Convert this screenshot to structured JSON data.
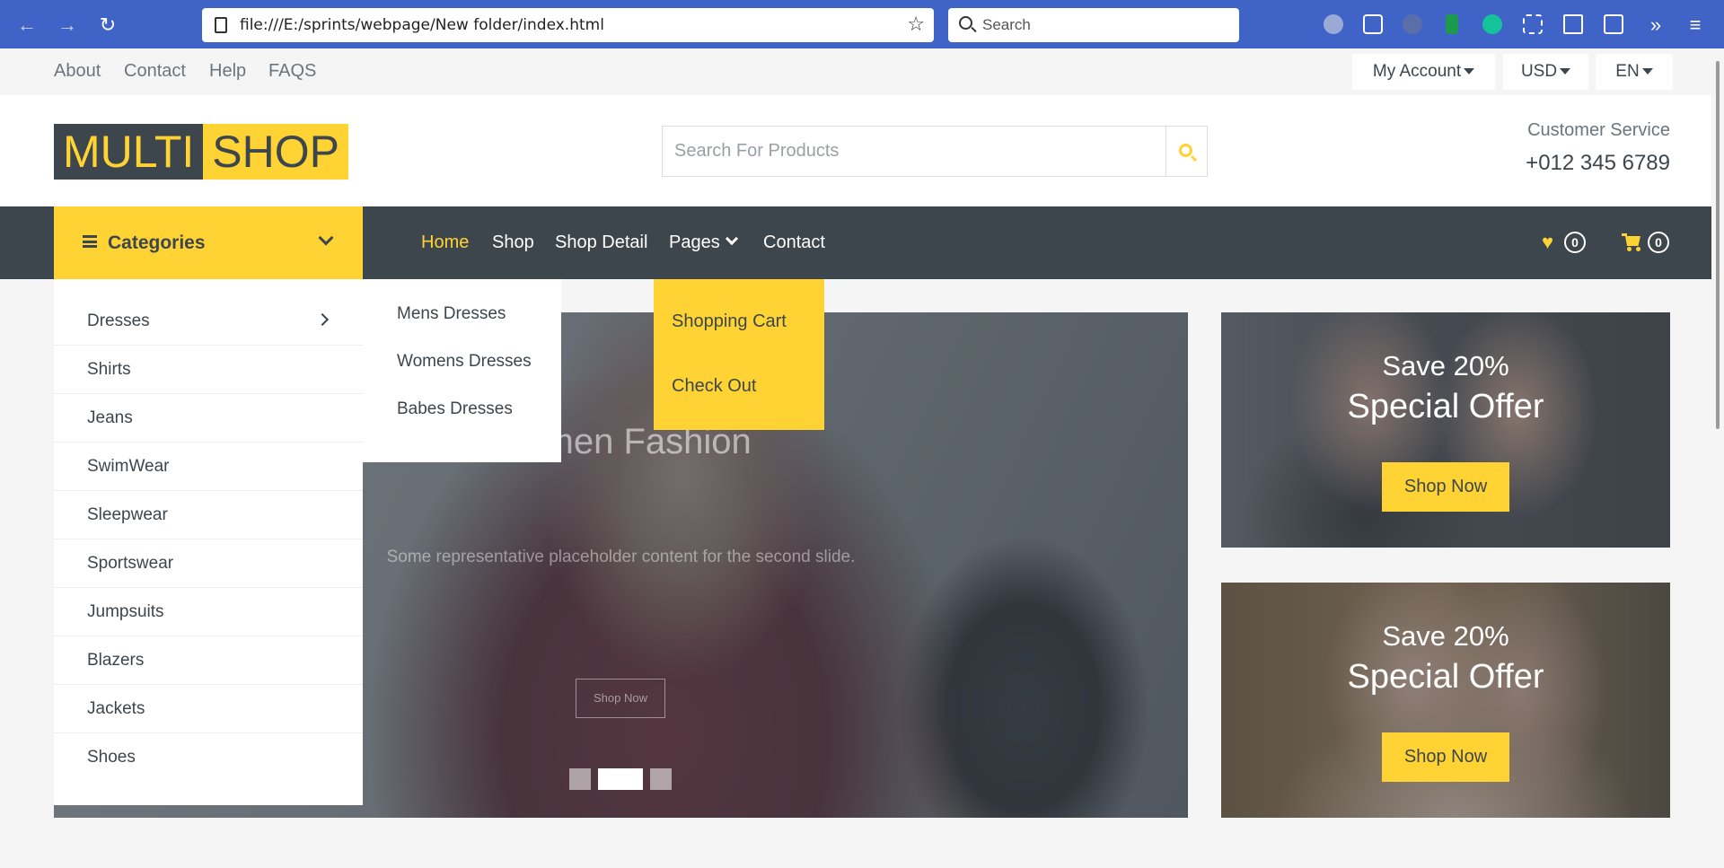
{
  "browser": {
    "url": "file:///E:/sprints/webpage/New folder/index.html",
    "search_placeholder": "Search",
    "back_icon": "←",
    "forward_icon": "→",
    "reload_icon": "↻",
    "star_icon": "☆",
    "overflow_icon": "»",
    "menu_icon": "≡"
  },
  "topbar": {
    "links": [
      "About",
      "Contact",
      "Help",
      "FAQS"
    ],
    "account": "My Account",
    "currency": "USD",
    "language": "EN"
  },
  "header": {
    "logo_part1": "MULTI",
    "logo_part2": "SHOP",
    "search_placeholder": "Search For Products",
    "customer_service_label": "Customer Service",
    "phone": "+012 345 6789"
  },
  "navbar": {
    "categories_label": "Categories",
    "menu": [
      "Home",
      "Shop",
      "Shop Detail",
      "Pages",
      "Contact"
    ],
    "active": "Home",
    "wishlist_count": "0",
    "cart_count": "0"
  },
  "categories": [
    "Dresses",
    "Shirts",
    "Jeans",
    "SwimWear",
    "Sleepwear",
    "Sportswear",
    "Jumpsuits",
    "Blazers",
    "Jackets",
    "Shoes"
  ],
  "dresses_submenu": [
    "Mens Dresses",
    "Womens Dresses",
    "Babes Dresses"
  ],
  "pages_dropdown": [
    "Shopping Cart",
    "Check Out"
  ],
  "hero": {
    "title": "Women Fashion",
    "caption": "Some representative placeholder content for the second slide.",
    "button": "Shop Now"
  },
  "offers": [
    {
      "save": "Save 20%",
      "title": "Special Offer",
      "button": "Shop Now"
    },
    {
      "save": "Save 20%",
      "title": "Special Offer",
      "button": "Shop Now"
    }
  ],
  "colors": {
    "primary": "#ffd333",
    "dark": "#3d464d",
    "browser_bar": "#3f63c6"
  }
}
